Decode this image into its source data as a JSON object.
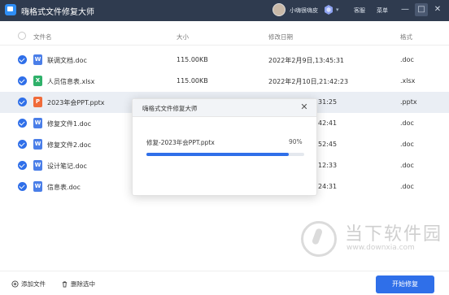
{
  "window": {
    "title": "嗨格式文件修复大师",
    "user_name": "小嗨很嗨皮",
    "links": [
      "客服",
      "菜单"
    ],
    "controls": [
      "—",
      "□",
      "✕"
    ]
  },
  "columns": {
    "name": "文件名",
    "size": "大小",
    "modified": "修改日期",
    "format": "格式"
  },
  "files": [
    {
      "name": "联调文档.doc",
      "type": "W",
      "size": "115.00KB",
      "modified": "2022年2月9日,13:45:31",
      "format": ".doc"
    },
    {
      "name": "人员信息表.xlsx",
      "type": "X",
      "size": "115.00KB",
      "modified": "2022年2月10日,21:42:23",
      "format": ".xlsx"
    },
    {
      "name": "2023年会PPT.pptx",
      "type": "P",
      "size": "",
      "modified": "31:25",
      "format": ".pptx"
    },
    {
      "name": "修复文件1.doc",
      "type": "W",
      "size": "",
      "modified": "42:41",
      "format": ".doc"
    },
    {
      "name": "修复文件2.doc",
      "type": "W",
      "size": "",
      "modified": "52:45",
      "format": ".doc"
    },
    {
      "name": "设计笔记.doc",
      "type": "W",
      "size": "",
      "modified": "12:33",
      "format": ".doc"
    },
    {
      "name": "信息表.doc",
      "type": "W",
      "size": "",
      "modified": "24:31",
      "format": ".doc"
    }
  ],
  "dialog": {
    "title": "嗨格式文件修复大师",
    "file_label": "修复-2023年会PPT.pptx",
    "percent_label": "90%",
    "progress": 0.9
  },
  "bottom": {
    "add_label": "添加文件",
    "delete_label": "删除选中",
    "start_label": "开始修复"
  },
  "watermark": {
    "text": "当下软件园",
    "url": "www.downxia.com"
  },
  "colors": {
    "titlebar": "#2f3b4f",
    "accent": "#2f6fe9",
    "doc": "#4a7ee8",
    "xlsx": "#2fb16a",
    "pptx": "#f06b3a"
  }
}
